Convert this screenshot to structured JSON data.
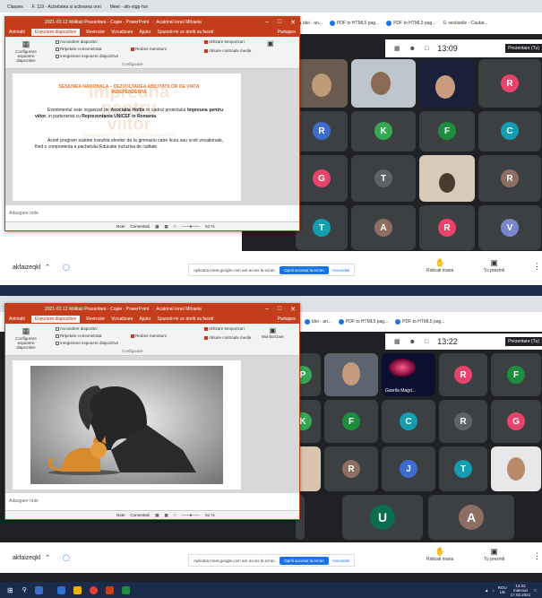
{
  "top": {
    "chrome": {
      "tabs": [
        "Classes",
        "F. 119 - Activitatea si activarea orei",
        "Meet - afo-xtgp-hor"
      ],
      "bookmarks": [
        "idei - an...",
        "PDF to HTML5 pag...",
        "PDF to HTML5 pag...",
        "sectiunile - Cautar..."
      ]
    },
    "meet": {
      "time": "13:09",
      "presenter_label": "Prezentare (Tu)",
      "tiles": [
        {
          "letter": "R",
          "color": "#e8436a"
        },
        {
          "letter": "R",
          "color": "#3f6ccf"
        },
        {
          "letter": "K",
          "color": "#34a853"
        },
        {
          "letter": "F",
          "color": "#1e8e3e"
        },
        {
          "letter": "C",
          "color": "#129eaf"
        },
        {
          "letter": "G",
          "color": "#e8436a"
        },
        {
          "letter": "T",
          "color": "#5f6368"
        },
        {
          "letter": "R",
          "color": "#8d6e63"
        },
        {
          "letter": "T",
          "color": "#129eaf"
        },
        {
          "letter": "A",
          "color": "#8d6e63"
        },
        {
          "letter": "R",
          "color": "#e8436a"
        },
        {
          "letter": "V",
          "color": "#7986cb"
        }
      ]
    },
    "ppt": {
      "title": "2021-02-12 Abilitati Prezentare - Copie - PowerPoint",
      "search": "Spuneti-mi ce doriti sa faceti",
      "user": "Acatrinei Ionel Mihaela",
      "tabs": [
        "Animatii",
        "Expunere diapozitive",
        "Revizuire",
        "Vizualizare",
        "Ajutor"
      ],
      "share": "Partajare",
      "ribbon": {
        "btn_config": "Configurare expunere diapozitive",
        "hide_slide": "Ascundere diapozitiv",
        "rehearse": "Repetare cronometrata",
        "record": "Inregistrare expunere diapozitive",
        "play_narr": "Redare narratiuni",
        "use_timing": "Utilizare temporizari",
        "show_media": "Afisare controale media",
        "monitor": "Monitorizare",
        "group": "Configurare"
      },
      "slide": {
        "title": "SESIUNEA NATIONALA – DEZVOLTAREA ABILITATILOR DE VIATA INDEPENDENTA",
        "p1a": "Evenimentul este organizat de ",
        "p1b": "Asociatia Holtis",
        "p1c": " in cadrul proiectului ",
        "p1d": "Impreuna pentru viitor",
        "p1e": ", in parteneriat cu ",
        "p1f": "Reprezentanta UNICEF in Romania",
        "p1g": ".",
        "p2": "Acest program sustine tranzitia elevilor de la gimnaziu catre liceu sau scoli vocationale, fiind o componenta a pachetului Educatie incluziva de calitate.",
        "wm1": "Impreuna",
        "wm2": "pentru",
        "wm3": "viitor",
        "wm4": "Impreuna pentru educatie incluziva de calitate"
      },
      "notes": "Adaugare note",
      "status_notes": "Note",
      "status_comments": "Comentarii",
      "zoom": "51 %"
    },
    "bottom": {
      "user": "akfaizeqkl",
      "share_msg": "Aplicatia meet.google.com are acces la ecran.",
      "stop": "Opriti accesul la ecran",
      "hide": "Ascundeti",
      "raise": "Ridicati mana",
      "present": "Tu prezinti"
    }
  },
  "bot": {
    "meet": {
      "time": "13:22",
      "presenter_label": "Prezentare (Tu)",
      "name_label": "Gavrila Magd...",
      "tiles": [
        {
          "letter": "P",
          "color": "#34a853"
        },
        {
          "letter": "R",
          "color": "#e8436a"
        },
        {
          "letter": "F",
          "color": "#1e8e3e"
        },
        {
          "letter": "K",
          "color": "#34a853"
        },
        {
          "letter": "F",
          "color": "#1e8e3e"
        },
        {
          "letter": "C",
          "color": "#129eaf"
        },
        {
          "letter": "R",
          "color": "#5f6368"
        },
        {
          "letter": "G",
          "color": "#e8436a"
        },
        {
          "letter": "R",
          "color": "#8d6e63"
        },
        {
          "letter": "J",
          "color": "#3f6ccf"
        },
        {
          "letter": "T",
          "color": "#129eaf"
        },
        {
          "letter": "U",
          "color": "#0b6e4f"
        },
        {
          "letter": "A",
          "color": "#8d6e63"
        }
      ]
    },
    "ppt": {
      "title": "2021-02-12 Abilitati Prezentare - Copie - PowerPoint",
      "search": "Spuneti-mi ce doriti sa faceti",
      "user": "Acatrinei Ionel Mihaela",
      "tabs": [
        "Animatii",
        "Expunere diapozitive",
        "Revizuire",
        "Vizualizare",
        "Ajutor"
      ],
      "share": "Partajare",
      "notes": "Adaugare note",
      "zoom": "51 %"
    },
    "bottom": {
      "user": "akfaizeqkl",
      "share_msg": "Aplicatia meet.google.com are acces la ecran.",
      "stop": "Opriti accesul la ecran",
      "hide": "Ascundeti",
      "raise": "Ridicati mana",
      "present": "Tu prezinti"
    },
    "taskbar": {
      "lang": "ROU",
      "lang2": "US",
      "time": "13:22",
      "day": "miercuri",
      "date": "17.02.2021"
    }
  }
}
